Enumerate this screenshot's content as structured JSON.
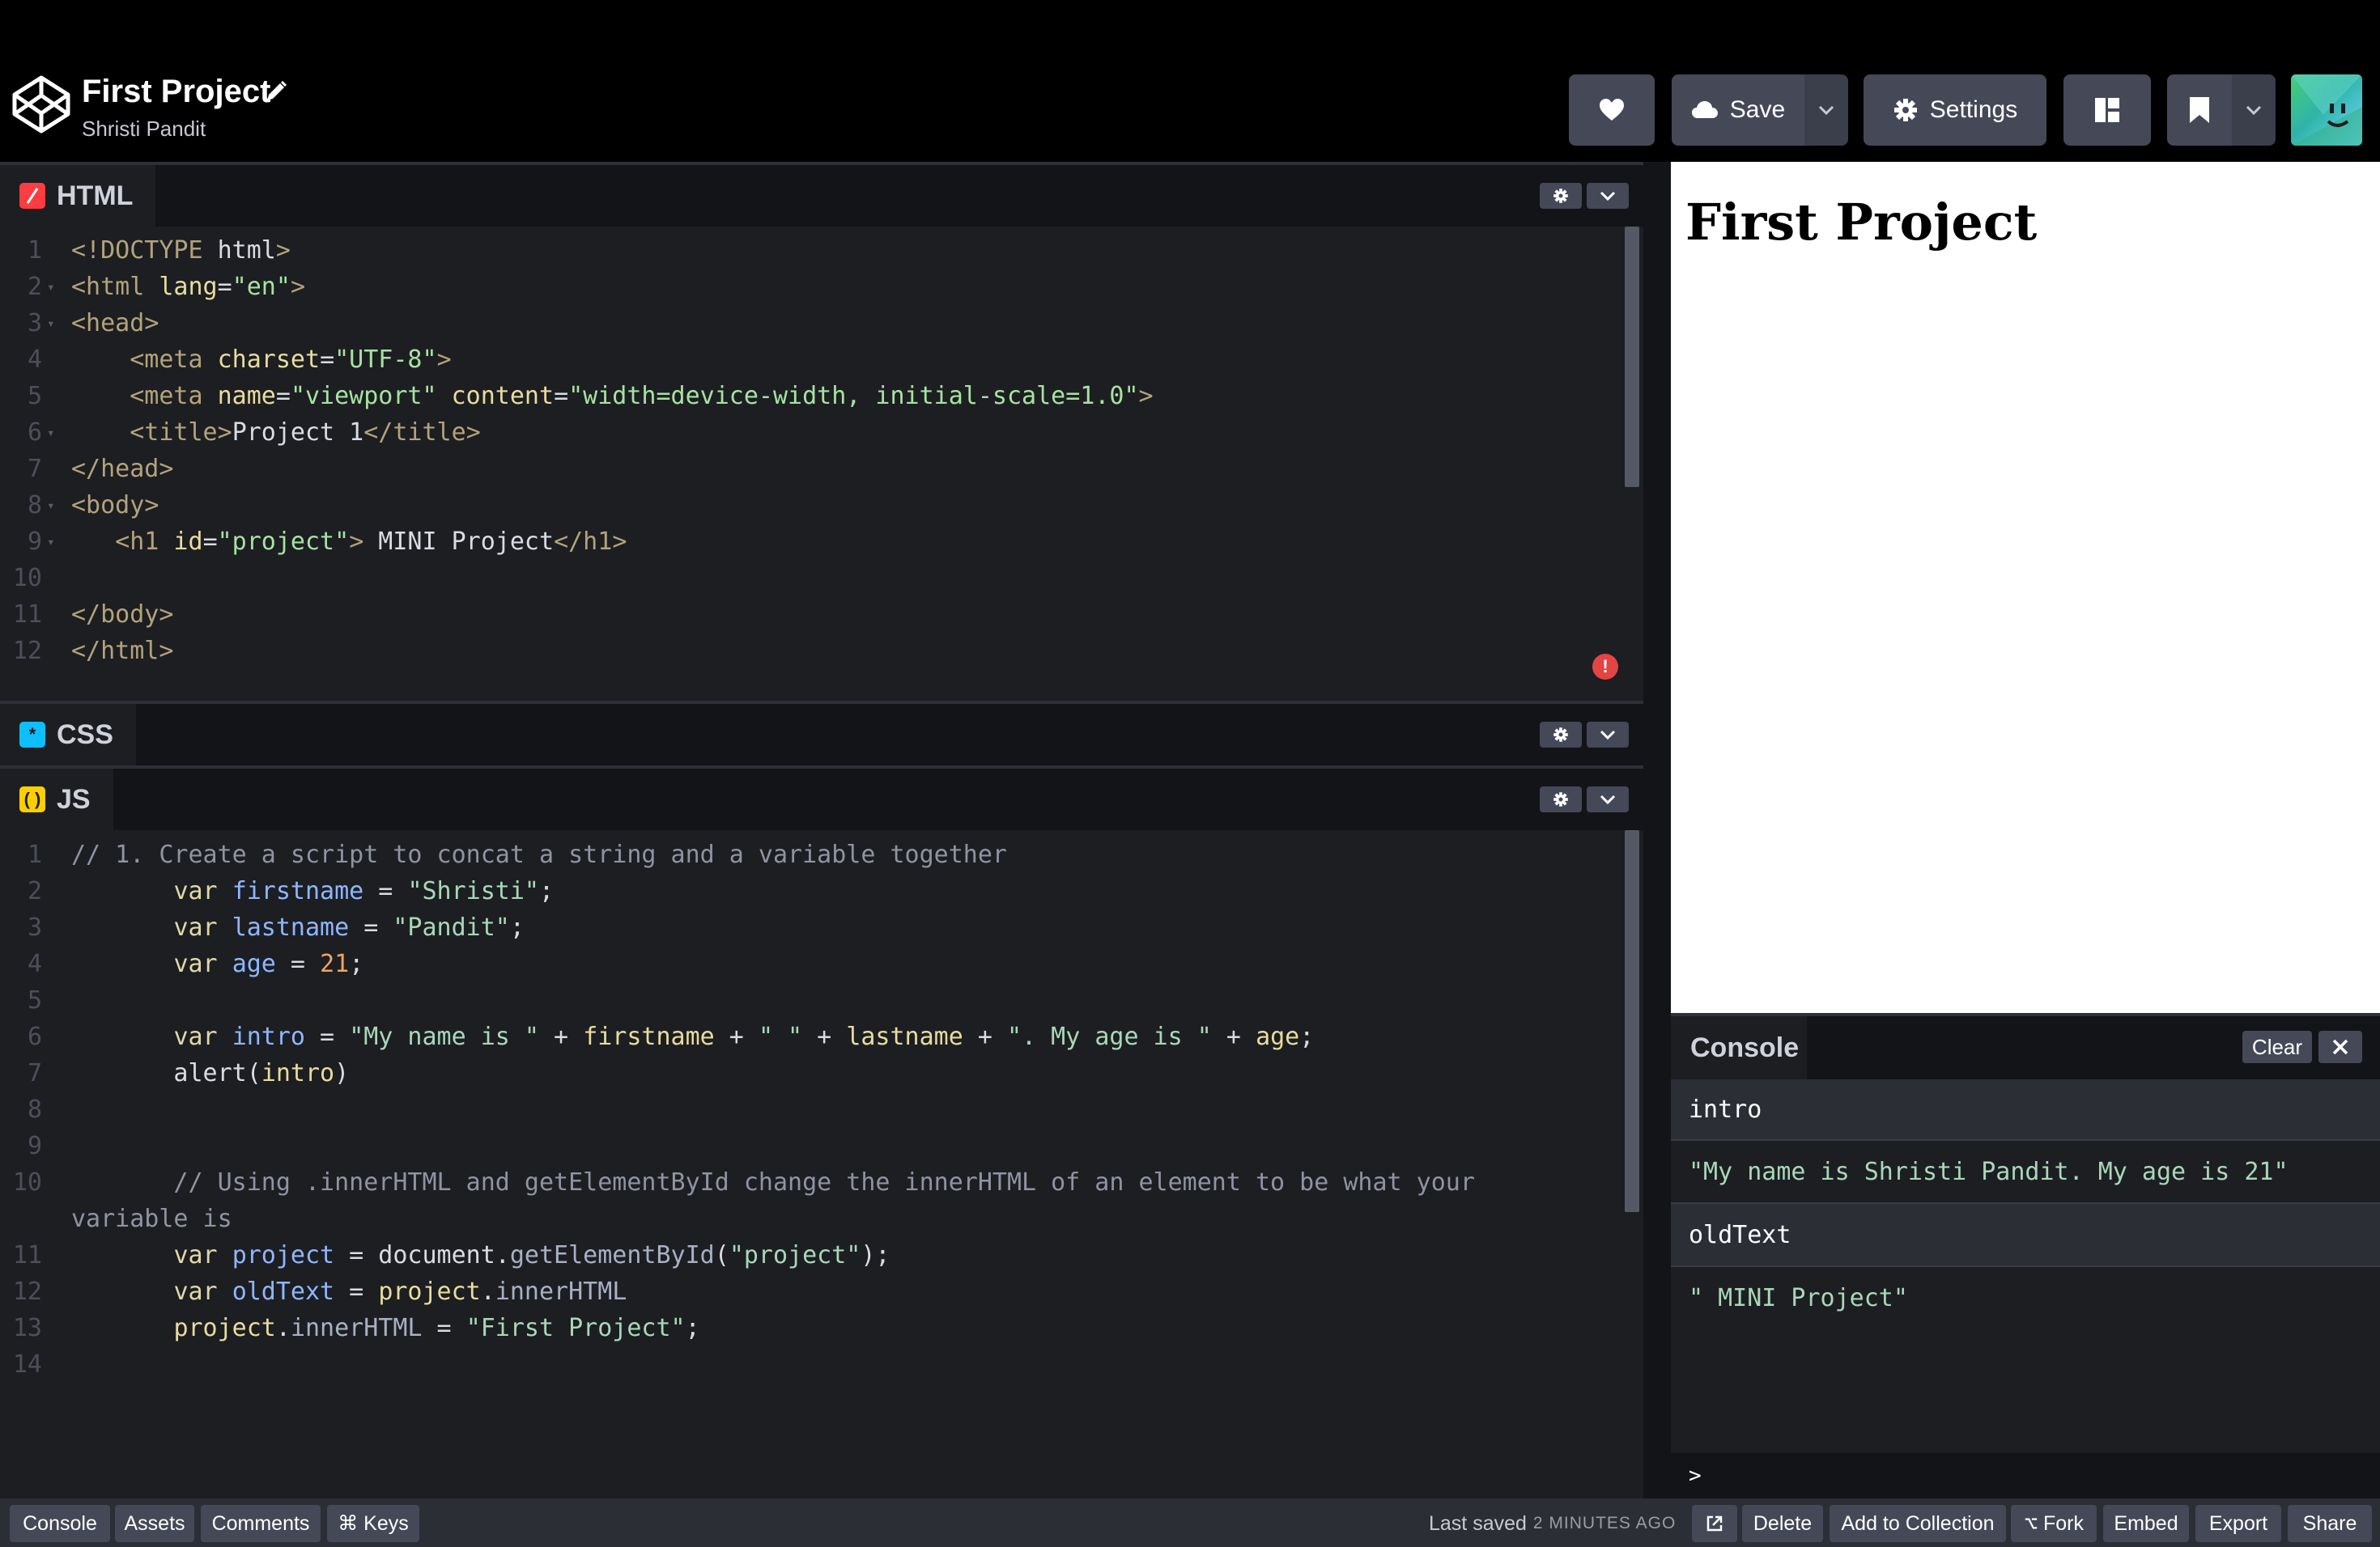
{
  "header": {
    "project_title": "First Project",
    "author": "Shristi Pandit",
    "save_label": "Save",
    "settings_label": "Settings"
  },
  "html_pane": {
    "label": "HTML",
    "icon": "html-icon",
    "color": "#ff3c41",
    "lines": [
      "<!DOCTYPE html>",
      "<html lang=\"en\">",
      "<head>",
      "    <meta charset=\"UTF-8\">",
      "    <meta name=\"viewport\" content=\"width=device-width, initial-scale=1.0\">",
      "    <title>Project 1</title>",
      "</head>",
      "<body>",
      "   <h1 id=\"project\"> MINI Project</h1>",
      "",
      "</body>",
      "</html>"
    ]
  },
  "css_pane": {
    "label": "CSS",
    "icon": "css-icon",
    "color": "#0ebeff"
  },
  "js_pane": {
    "label": "JS",
    "icon": "js-icon",
    "color": "#fcd000",
    "lines": [
      "// 1. Create a script to concat a string and a variable together",
      "       var firstname = \"Shristi\";",
      "       var lastname = \"Pandit\";",
      "       var age = 21;",
      "",
      "       var intro = \"My name is \" + firstname + \" \" + lastname + \". My age is \" + age;",
      "       alert(intro)",
      "",
      "",
      "       // Using .innerHTML and getElementById change the innerHTML of an element to be what your",
      "variable is",
      "       var project = document.getElementById(\"project\");",
      "       var oldText = project.innerHTML",
      "       project.innerHTML = \"First Project\";",
      ""
    ],
    "line_numbers": [
      "1",
      "2",
      "3",
      "4",
      "5",
      "6",
      "7",
      "8",
      "9",
      "10",
      "",
      "11",
      "12",
      "13",
      "14"
    ]
  },
  "preview": {
    "heading": "First Project"
  },
  "console": {
    "title": "Console",
    "clear_label": "Clear",
    "entries": [
      {
        "input": "intro",
        "output": "\"My name is Shristi Pandit. My age is 21\""
      },
      {
        "input": "oldText",
        "output": "\" MINI Project\""
      }
    ],
    "prompt": ">"
  },
  "footer": {
    "console_label": "Console",
    "assets_label": "Assets",
    "comments_label": "Comments",
    "keys_label": "⌘ Keys",
    "last_saved_label": "Last saved",
    "last_saved_ago": "2 MINUTES AGO",
    "delete_label": "Delete",
    "add_to_collection_label": "Add to Collection",
    "fork_label": "Fork",
    "embed_label": "Embed",
    "export_label": "Export",
    "share_label": "Share"
  },
  "colors": {
    "editor_bg": "#1d1e22",
    "button_bg": "#444857",
    "error": "#e34444"
  }
}
